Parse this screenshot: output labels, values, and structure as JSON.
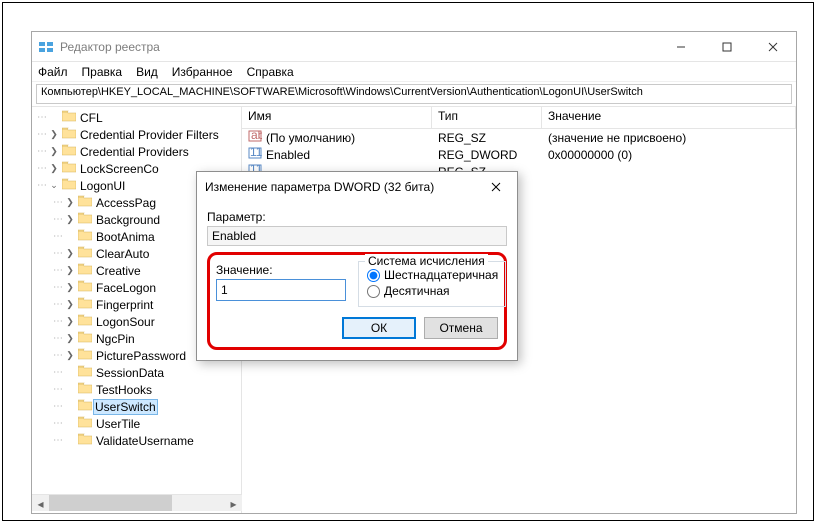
{
  "window": {
    "title": "Редактор реестра",
    "min": "—",
    "max": "☐",
    "close": "✕"
  },
  "menu": {
    "file": "Файл",
    "edit": "Правка",
    "view": "Вид",
    "fav": "Избранное",
    "help": "Справка"
  },
  "address": "Компьютер\\HKEY_LOCAL_MACHINE\\SOFTWARE\\Microsoft\\Windows\\CurrentVersion\\Authentication\\LogonUI\\UserSwitch",
  "tree": {
    "nodes": [
      {
        "label": "CFL",
        "exp": ""
      },
      {
        "label": "Credential Provider Filters",
        "exp": ">"
      },
      {
        "label": "Credential Providers",
        "exp": ">"
      },
      {
        "label": "LockScreenCo",
        "exp": ">"
      },
      {
        "label": "LogonUI",
        "exp": "v",
        "children": [
          {
            "label": "AccessPag",
            "exp": ">"
          },
          {
            "label": "Background",
            "exp": ">"
          },
          {
            "label": "BootAnima",
            "exp": ""
          },
          {
            "label": "ClearAuto",
            "exp": ">"
          },
          {
            "label": "Creative",
            "exp": ">"
          },
          {
            "label": "FaceLogon",
            "exp": ">"
          },
          {
            "label": "Fingerprint",
            "exp": ">"
          },
          {
            "label": "LogonSour",
            "exp": ">"
          },
          {
            "label": "NgcPin",
            "exp": ">"
          },
          {
            "label": "PicturePassword",
            "exp": ">"
          },
          {
            "label": "SessionData",
            "exp": ""
          },
          {
            "label": "TestHooks",
            "exp": ""
          },
          {
            "label": "UserSwitch",
            "exp": "",
            "selected": true
          },
          {
            "label": "UserTile",
            "exp": ""
          },
          {
            "label": "ValidateUsername",
            "exp": ""
          }
        ]
      }
    ]
  },
  "list": {
    "headers": {
      "name": "Имя",
      "type": "Тип",
      "value": "Значение"
    },
    "rows": [
      {
        "name": "(По умолчанию)",
        "type": "REG_SZ",
        "value": "(значение не присвоено)",
        "icon": "str"
      },
      {
        "name": "Enabled",
        "type": "REG_DWORD",
        "value": "0x00000000 (0)",
        "icon": "bin"
      },
      {
        "name": "",
        "type": "REG_SZ",
        "value": "",
        "icon": "bin"
      }
    ]
  },
  "dialog": {
    "title": "Изменение параметра DWORD (32 бита)",
    "param_label": "Параметр:",
    "param_value": "Enabled",
    "value_label": "Значение:",
    "value_input": "1",
    "base_label": "Система исчисления",
    "hex": "Шестнадцатеричная",
    "dec": "Десятичная",
    "ok": "ОК",
    "cancel": "Отмена"
  }
}
